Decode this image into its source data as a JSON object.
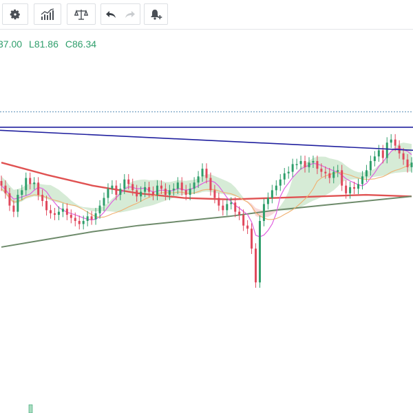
{
  "toolbar": {
    "items": [
      {
        "name": "settings",
        "icon": "gear-icon"
      },
      {
        "name": "indicators",
        "icon": "bar-chart-icon"
      },
      {
        "name": "compare",
        "icon": "scales-icon"
      },
      {
        "name": "undo",
        "icon": "undo-icon"
      },
      {
        "name": "redo",
        "icon": "redo-icon"
      },
      {
        "name": "alert",
        "icon": "bell-plus-icon"
      }
    ]
  },
  "ohlc": {
    "open_partial": "37.00",
    "low_label": "L",
    "low_value": "81.86",
    "close_label": "C",
    "close_value": "86.34"
  },
  "colors": {
    "up": "#2e9e6b",
    "down": "#e0485c",
    "trendline": "#1f1f9e",
    "ma_red": "#e05252",
    "ma_gray": "#6d8a6a",
    "ma_pink": "#e060e0",
    "ma_orange": "#f0b070",
    "cloud_green": "#cfe8cf",
    "cloud_red": "#f7d2d2",
    "dotted_level": "#5b8fb8"
  },
  "chart_data": {
    "type": "candlestick",
    "y_visible_range": [
      70,
      95
    ],
    "dotted_level": 89.6,
    "trendlines": [
      {
        "name": "horizontal",
        "y_start": 88.6,
        "y_end": 88.6
      },
      {
        "name": "descending",
        "y_start": 88.4,
        "y_end": 87.1
      }
    ],
    "closes": [
      84.8,
      84.3,
      83.5,
      83.1,
      84.2,
      84.5,
      85.3,
      84.9,
      85.0,
      84.2,
      83.8,
      83.2,
      83.0,
      82.9,
      83.1,
      83.3,
      82.9,
      82.7,
      82.5,
      82.3,
      82.5,
      82.8,
      82.6,
      83.0,
      83.5,
      84.0,
      84.6,
      84.8,
      84.2,
      84.6,
      85.2,
      84.9,
      84.5,
      84.1,
      84.4,
      84.7,
      84.4,
      84.2,
      84.8,
      84.6,
      84.2,
      84.5,
      84.6,
      85.0,
      84.5,
      84.2,
      84.6,
      85.0,
      85.4,
      85.9,
      85.3,
      84.5,
      84.0,
      83.5,
      83.2,
      83.6,
      83.7,
      83.1,
      82.9,
      82.2,
      82.0,
      80.7,
      78.5,
      82.5,
      83.6,
      84.0,
      84.5,
      84.8,
      85.2,
      85.6,
      85.7,
      86.2,
      86.2,
      86.4,
      86.0,
      86.3,
      86.4,
      85.9,
      85.7,
      85.6,
      85.3,
      85.7,
      85.8,
      84.8,
      84.3,
      84.7,
      84.6,
      84.9,
      85.4,
      85.8,
      86.4,
      86.7,
      87.1,
      86.6,
      87.6,
      87.8,
      87.4,
      86.9,
      86.5,
      86.0,
      86.3
    ],
    "series": [
      {
        "name": "ma_red",
        "values": [
          86.3,
          85.5,
          84.8,
          84.3,
          84.0,
          83.9,
          84.0,
          84.1,
          84.2,
          84.1
        ]
      },
      {
        "name": "ma_gray",
        "values": [
          80.8,
          81.3,
          81.8,
          82.2,
          82.5,
          82.8,
          83.2,
          83.5,
          83.8,
          84.1
        ]
      }
    ]
  }
}
